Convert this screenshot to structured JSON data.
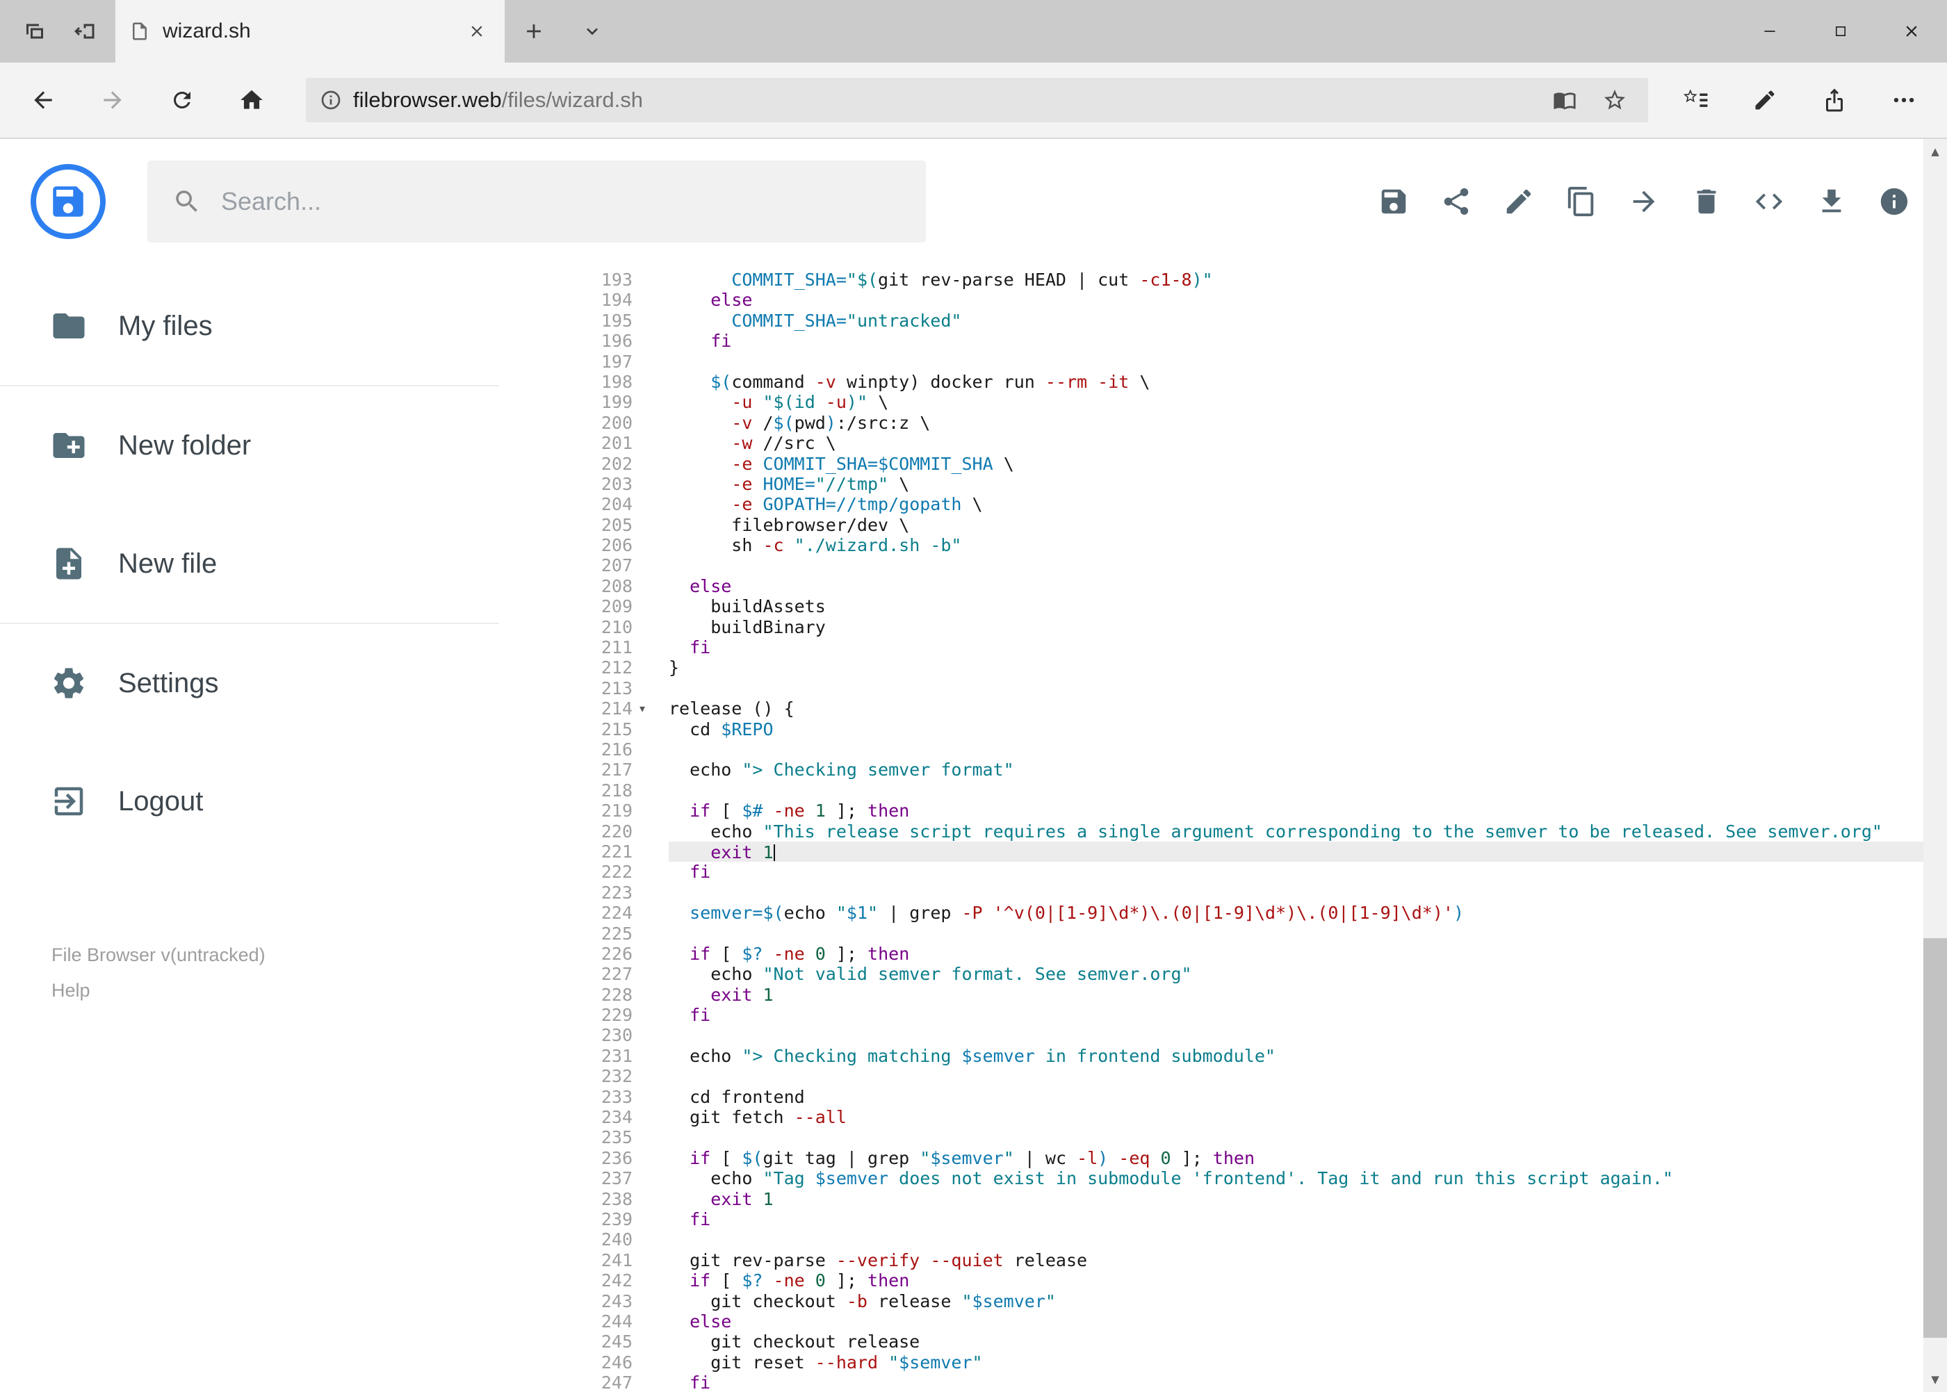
{
  "browser": {
    "tab_title": "wizard.sh",
    "url_host": "filebrowser.web",
    "url_path": "/files/wizard.sh"
  },
  "header": {
    "search_placeholder": "Search...",
    "toolbar": [
      {
        "name": "save",
        "icon": "save-icon"
      },
      {
        "name": "share",
        "icon": "share-icon"
      },
      {
        "name": "rename",
        "icon": "pencil-icon"
      },
      {
        "name": "copy",
        "icon": "copy-icon"
      },
      {
        "name": "move",
        "icon": "move-arrow-icon"
      },
      {
        "name": "delete",
        "icon": "trash-icon"
      },
      {
        "name": "source-code",
        "icon": "code-icon"
      },
      {
        "name": "download",
        "icon": "download-icon"
      },
      {
        "name": "info",
        "icon": "info-icon"
      }
    ]
  },
  "sidebar": {
    "items": [
      {
        "label": "My files",
        "icon": "folder-icon",
        "divider_after": true
      },
      {
        "label": "New folder",
        "icon": "folder-plus-icon",
        "divider_after": false
      },
      {
        "label": "New file",
        "icon": "file-plus-icon",
        "divider_after": true
      },
      {
        "label": "Settings",
        "icon": "gear-icon",
        "divider_after": false
      },
      {
        "label": "Logout",
        "icon": "logout-icon",
        "divider_after": false
      }
    ],
    "footer_version": "File Browser v(untracked)",
    "footer_help": "Help"
  },
  "colors": {
    "logo_blue": "#2d7ff0",
    "toolbar_icon": "#546671",
    "sidebar_icon": "#546e7a",
    "active_line_bg": "#ececec"
  },
  "editor": {
    "active_line": 221,
    "fold_line": 214,
    "palette": {
      "p": "#1a1a1a",
      "k": "#770088",
      "s": "#0a7e8c",
      "s2": "#aa1111",
      "d": "#0f7ab0",
      "v": "#0f7ab0",
      "a": "#aa1111",
      "n": "#116644"
    },
    "lines": [
      {
        "n": 193,
        "t": [
          [
            "p",
            "      "
          ],
          [
            "d",
            "COMMIT_SHA="
          ],
          [
            "s",
            "\"$("
          ],
          [
            "p",
            "git rev-parse HEAD | cut "
          ],
          [
            "a",
            "-c1-8"
          ],
          [
            "s",
            ")\""
          ]
        ]
      },
      {
        "n": 194,
        "t": [
          [
            "p",
            "    "
          ],
          [
            "k",
            "else"
          ]
        ]
      },
      {
        "n": 195,
        "t": [
          [
            "p",
            "      "
          ],
          [
            "d",
            "COMMIT_SHA="
          ],
          [
            "s",
            "\"untracked\""
          ]
        ]
      },
      {
        "n": 196,
        "t": [
          [
            "p",
            "    "
          ],
          [
            "k",
            "fi"
          ]
        ]
      },
      {
        "n": 197,
        "t": []
      },
      {
        "n": 198,
        "t": [
          [
            "p",
            "    "
          ],
          [
            "v",
            "$("
          ],
          [
            "p",
            "command "
          ],
          [
            "a",
            "-v"
          ],
          [
            "p",
            " winpty) docker run "
          ],
          [
            "a",
            "--rm"
          ],
          [
            "p",
            " "
          ],
          [
            "a",
            "-it"
          ],
          [
            "p",
            " \\"
          ]
        ]
      },
      {
        "n": 199,
        "t": [
          [
            "p",
            "      "
          ],
          [
            "a",
            "-u"
          ],
          [
            "p",
            " "
          ],
          [
            "s",
            "\"$(id "
          ],
          [
            "a",
            "-u"
          ],
          [
            "s",
            ")\""
          ],
          [
            "p",
            " \\"
          ]
        ]
      },
      {
        "n": 200,
        "t": [
          [
            "p",
            "      "
          ],
          [
            "a",
            "-v"
          ],
          [
            "p",
            " /"
          ],
          [
            "v",
            "$("
          ],
          [
            "p",
            "pwd"
          ],
          [
            "v",
            ")"
          ],
          [
            "p",
            ":/src:z \\"
          ]
        ]
      },
      {
        "n": 201,
        "t": [
          [
            "p",
            "      "
          ],
          [
            "a",
            "-w"
          ],
          [
            "p",
            " //src \\"
          ]
        ]
      },
      {
        "n": 202,
        "t": [
          [
            "p",
            "      "
          ],
          [
            "a",
            "-e"
          ],
          [
            "p",
            " "
          ],
          [
            "d",
            "COMMIT_SHA="
          ],
          [
            "v",
            "$COMMIT_SHA"
          ],
          [
            "p",
            " \\"
          ]
        ]
      },
      {
        "n": 203,
        "t": [
          [
            "p",
            "      "
          ],
          [
            "a",
            "-e"
          ],
          [
            "p",
            " "
          ],
          [
            "d",
            "HOME="
          ],
          [
            "s",
            "\"//tmp\""
          ],
          [
            "p",
            " \\"
          ]
        ]
      },
      {
        "n": 204,
        "t": [
          [
            "p",
            "      "
          ],
          [
            "a",
            "-e"
          ],
          [
            "p",
            " "
          ],
          [
            "d",
            "GOPATH=//tmp/gopath"
          ],
          [
            "p",
            " \\"
          ]
        ]
      },
      {
        "n": 205,
        "t": [
          [
            "p",
            "      filebrowser/dev \\"
          ]
        ]
      },
      {
        "n": 206,
        "t": [
          [
            "p",
            "      sh "
          ],
          [
            "a",
            "-c"
          ],
          [
            "p",
            " "
          ],
          [
            "s",
            "\"./wizard.sh -b\""
          ]
        ]
      },
      {
        "n": 207,
        "t": []
      },
      {
        "n": 208,
        "t": [
          [
            "p",
            "  "
          ],
          [
            "k",
            "else"
          ]
        ]
      },
      {
        "n": 209,
        "t": [
          [
            "p",
            "    buildAssets"
          ]
        ]
      },
      {
        "n": 210,
        "t": [
          [
            "p",
            "    buildBinary"
          ]
        ]
      },
      {
        "n": 211,
        "t": [
          [
            "p",
            "  "
          ],
          [
            "k",
            "fi"
          ]
        ]
      },
      {
        "n": 212,
        "t": [
          [
            "p",
            "}"
          ]
        ]
      },
      {
        "n": 213,
        "t": []
      },
      {
        "n": 214,
        "fold": true,
        "t": [
          [
            "p",
            "release () {"
          ]
        ]
      },
      {
        "n": 215,
        "t": [
          [
            "p",
            "  cd "
          ],
          [
            "v",
            "$REPO"
          ]
        ]
      },
      {
        "n": 216,
        "t": []
      },
      {
        "n": 217,
        "t": [
          [
            "p",
            "  echo "
          ],
          [
            "s",
            "\"> Checking semver format\""
          ]
        ]
      },
      {
        "n": 218,
        "t": []
      },
      {
        "n": 219,
        "t": [
          [
            "p",
            "  "
          ],
          [
            "k",
            "if"
          ],
          [
            "p",
            " [ "
          ],
          [
            "v",
            "$#"
          ],
          [
            "p",
            " "
          ],
          [
            "a",
            "-ne"
          ],
          [
            "p",
            " "
          ],
          [
            "n",
            "1"
          ],
          [
            "p",
            " ]; "
          ],
          [
            "k",
            "then"
          ]
        ]
      },
      {
        "n": 220,
        "t": [
          [
            "p",
            "    echo "
          ],
          [
            "s",
            "\"This release script requires a single argument corresponding to the semver to be released. See semver.org\""
          ]
        ]
      },
      {
        "n": 221,
        "active": true,
        "cursor": true,
        "t": [
          [
            "p",
            "    "
          ],
          [
            "k",
            "exit"
          ],
          [
            "p",
            " "
          ],
          [
            "n",
            "1"
          ]
        ]
      },
      {
        "n": 222,
        "t": [
          [
            "p",
            "  "
          ],
          [
            "k",
            "fi"
          ]
        ]
      },
      {
        "n": 223,
        "t": []
      },
      {
        "n": 224,
        "t": [
          [
            "p",
            "  "
          ],
          [
            "d",
            "semver="
          ],
          [
            "v",
            "$("
          ],
          [
            "p",
            "echo "
          ],
          [
            "s",
            "\""
          ],
          [
            "v",
            "$1"
          ],
          [
            "s",
            "\""
          ],
          [
            "p",
            " | grep "
          ],
          [
            "a",
            "-P"
          ],
          [
            "p",
            " "
          ],
          [
            "s2",
            "'^v(0|[1-9]\\d*)\\.(0|[1-9]\\d*)\\.(0|[1-9]\\d*)'"
          ],
          [
            "v",
            ")"
          ]
        ]
      },
      {
        "n": 225,
        "t": []
      },
      {
        "n": 226,
        "t": [
          [
            "p",
            "  "
          ],
          [
            "k",
            "if"
          ],
          [
            "p",
            " [ "
          ],
          [
            "v",
            "$?"
          ],
          [
            "p",
            " "
          ],
          [
            "a",
            "-ne"
          ],
          [
            "p",
            " "
          ],
          [
            "n",
            "0"
          ],
          [
            "p",
            " ]; "
          ],
          [
            "k",
            "then"
          ]
        ]
      },
      {
        "n": 227,
        "t": [
          [
            "p",
            "    echo "
          ],
          [
            "s",
            "\"Not valid semver format. See semver.org\""
          ]
        ]
      },
      {
        "n": 228,
        "t": [
          [
            "p",
            "    "
          ],
          [
            "k",
            "exit"
          ],
          [
            "p",
            " "
          ],
          [
            "n",
            "1"
          ]
        ]
      },
      {
        "n": 229,
        "t": [
          [
            "p",
            "  "
          ],
          [
            "k",
            "fi"
          ]
        ]
      },
      {
        "n": 230,
        "t": []
      },
      {
        "n": 231,
        "t": [
          [
            "p",
            "  echo "
          ],
          [
            "s",
            "\"> Checking matching "
          ],
          [
            "v",
            "$semver"
          ],
          [
            "s",
            " in frontend submodule\""
          ]
        ]
      },
      {
        "n": 232,
        "t": []
      },
      {
        "n": 233,
        "t": [
          [
            "p",
            "  cd frontend"
          ]
        ]
      },
      {
        "n": 234,
        "t": [
          [
            "p",
            "  git fetch "
          ],
          [
            "a",
            "--all"
          ]
        ]
      },
      {
        "n": 235,
        "t": []
      },
      {
        "n": 236,
        "t": [
          [
            "p",
            "  "
          ],
          [
            "k",
            "if"
          ],
          [
            "p",
            " [ "
          ],
          [
            "v",
            "$("
          ],
          [
            "p",
            "git tag | grep "
          ],
          [
            "s",
            "\""
          ],
          [
            "v",
            "$semver"
          ],
          [
            "s",
            "\""
          ],
          [
            "p",
            " | wc "
          ],
          [
            "a",
            "-l"
          ],
          [
            "v",
            ")"
          ],
          [
            "p",
            " "
          ],
          [
            "a",
            "-eq"
          ],
          [
            "p",
            " "
          ],
          [
            "n",
            "0"
          ],
          [
            "p",
            " ]; "
          ],
          [
            "k",
            "then"
          ]
        ]
      },
      {
        "n": 237,
        "t": [
          [
            "p",
            "    echo "
          ],
          [
            "s",
            "\"Tag "
          ],
          [
            "v",
            "$semver"
          ],
          [
            "s",
            " does not exist in submodule 'frontend'. Tag it and run this script again.\""
          ]
        ]
      },
      {
        "n": 238,
        "t": [
          [
            "p",
            "    "
          ],
          [
            "k",
            "exit"
          ],
          [
            "p",
            " "
          ],
          [
            "n",
            "1"
          ]
        ]
      },
      {
        "n": 239,
        "t": [
          [
            "p",
            "  "
          ],
          [
            "k",
            "fi"
          ]
        ]
      },
      {
        "n": 240,
        "t": []
      },
      {
        "n": 241,
        "t": [
          [
            "p",
            "  git rev-parse "
          ],
          [
            "a",
            "--verify"
          ],
          [
            "p",
            " "
          ],
          [
            "a",
            "--quiet"
          ],
          [
            "p",
            " release"
          ]
        ]
      },
      {
        "n": 242,
        "t": [
          [
            "p",
            "  "
          ],
          [
            "k",
            "if"
          ],
          [
            "p",
            " [ "
          ],
          [
            "v",
            "$?"
          ],
          [
            "p",
            " "
          ],
          [
            "a",
            "-ne"
          ],
          [
            "p",
            " "
          ],
          [
            "n",
            "0"
          ],
          [
            "p",
            " ]; "
          ],
          [
            "k",
            "then"
          ]
        ]
      },
      {
        "n": 243,
        "t": [
          [
            "p",
            "    git checkout "
          ],
          [
            "a",
            "-b"
          ],
          [
            "p",
            " release "
          ],
          [
            "s",
            "\""
          ],
          [
            "v",
            "$semver"
          ],
          [
            "s",
            "\""
          ]
        ]
      },
      {
        "n": 244,
        "t": [
          [
            "p",
            "  "
          ],
          [
            "k",
            "else"
          ]
        ]
      },
      {
        "n": 245,
        "t": [
          [
            "p",
            "    git checkout release"
          ]
        ]
      },
      {
        "n": 246,
        "t": [
          [
            "p",
            "    git reset "
          ],
          [
            "a",
            "--hard"
          ],
          [
            "p",
            " "
          ],
          [
            "s",
            "\""
          ],
          [
            "v",
            "$semver"
          ],
          [
            "s",
            "\""
          ]
        ]
      },
      {
        "n": 247,
        "t": [
          [
            "p",
            "  "
          ],
          [
            "k",
            "fi"
          ]
        ]
      }
    ]
  }
}
